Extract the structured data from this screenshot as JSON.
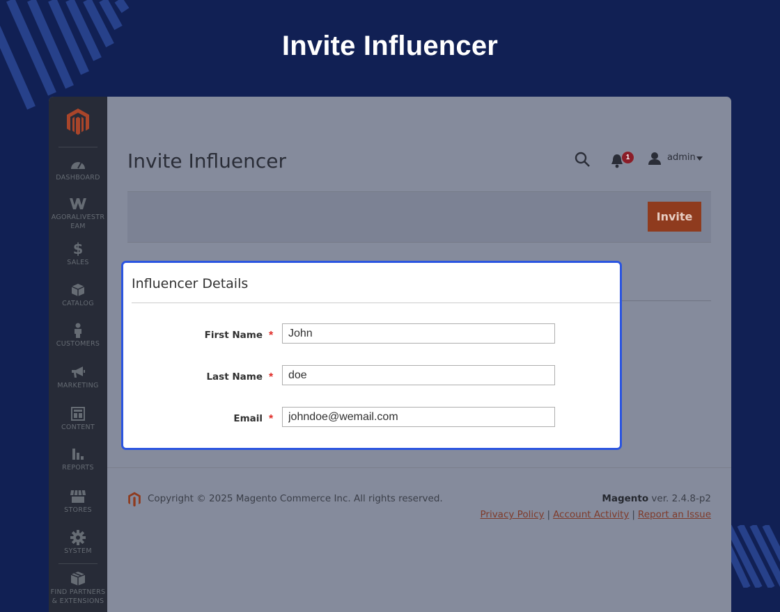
{
  "banner": {
    "title": "Invite Influencer"
  },
  "sidebar": {
    "items": [
      {
        "label": "DASHBOARD",
        "icon": "dashboard-icon"
      },
      {
        "label": "AGORALIVESTR EAM",
        "icon": "agoralivestream-icon"
      },
      {
        "label": "SALES",
        "icon": "dollar-icon"
      },
      {
        "label": "CATALOG",
        "icon": "cube-icon"
      },
      {
        "label": "CUSTOMERS",
        "icon": "person-icon"
      },
      {
        "label": "MARKETING",
        "icon": "megaphone-icon"
      },
      {
        "label": "CONTENT",
        "icon": "layout-icon"
      },
      {
        "label": "REPORTS",
        "icon": "bar-chart-icon"
      },
      {
        "label": "STORES",
        "icon": "store-icon"
      },
      {
        "label": "SYSTEM",
        "icon": "gear-icon"
      },
      {
        "label": "FIND PARTNERS & EXTENSIONS",
        "icon": "box-icon"
      }
    ]
  },
  "header": {
    "page_title": "Invite Influencer",
    "notification_count": "1",
    "user_name": "admin"
  },
  "actions": {
    "invite_label": "Invite"
  },
  "form": {
    "section_title": "Influencer Details",
    "required_marker": "*",
    "fields": [
      {
        "label": "First Name",
        "value": "John"
      },
      {
        "label": "Last Name",
        "value": "doe"
      },
      {
        "label": "Email",
        "value": "johndoe@wemail.com"
      }
    ]
  },
  "footer": {
    "copyright": "Copyright © 2025 Magento Commerce Inc. All rights reserved.",
    "brand": "Magento",
    "version": "ver. 2.4.8-p2",
    "links": [
      "Privacy Policy",
      "Account Activity",
      "Report an Issue"
    ],
    "separator": "|"
  },
  "colors": {
    "background": "#112054",
    "sidebar": "#272b37",
    "accent_button": "#8f3b1e",
    "card_border": "#2b55e0",
    "required": "#e02b27",
    "link": "#7f3b2a"
  }
}
